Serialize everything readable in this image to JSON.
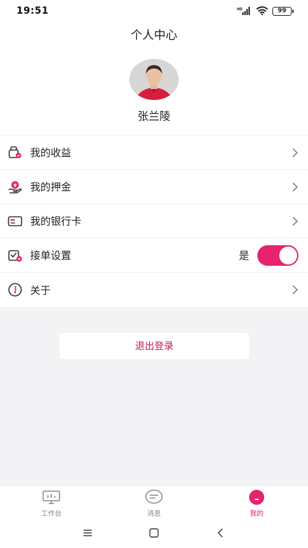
{
  "status_bar": {
    "time": "19:51",
    "battery": "99",
    "network": "HD"
  },
  "header": {
    "title": "个人中心"
  },
  "profile": {
    "name": "张兰陵",
    "avatar": "user-photo"
  },
  "menu": {
    "items": [
      {
        "label": "我的收益",
        "icon": "earnings-icon"
      },
      {
        "label": "我的押金",
        "icon": "deposit-icon"
      },
      {
        "label": "我的银行卡",
        "icon": "bank-card-icon"
      },
      {
        "label": "接单设置",
        "icon": "order-settings-icon",
        "value": "是",
        "toggle_on": true
      },
      {
        "label": "关于",
        "icon": "info-icon"
      }
    ]
  },
  "logout": {
    "label": "退出登录"
  },
  "tabbar": {
    "tabs": [
      {
        "label": "工作台",
        "icon": "workbench-icon",
        "active": false
      },
      {
        "label": "消息",
        "icon": "message-icon",
        "active": false
      },
      {
        "label": "我的",
        "icon": "profile-icon",
        "active": true
      }
    ]
  },
  "colors": {
    "accent": "#e5236e",
    "background": "#f3f3f5",
    "logout_text": "#c2185b"
  }
}
